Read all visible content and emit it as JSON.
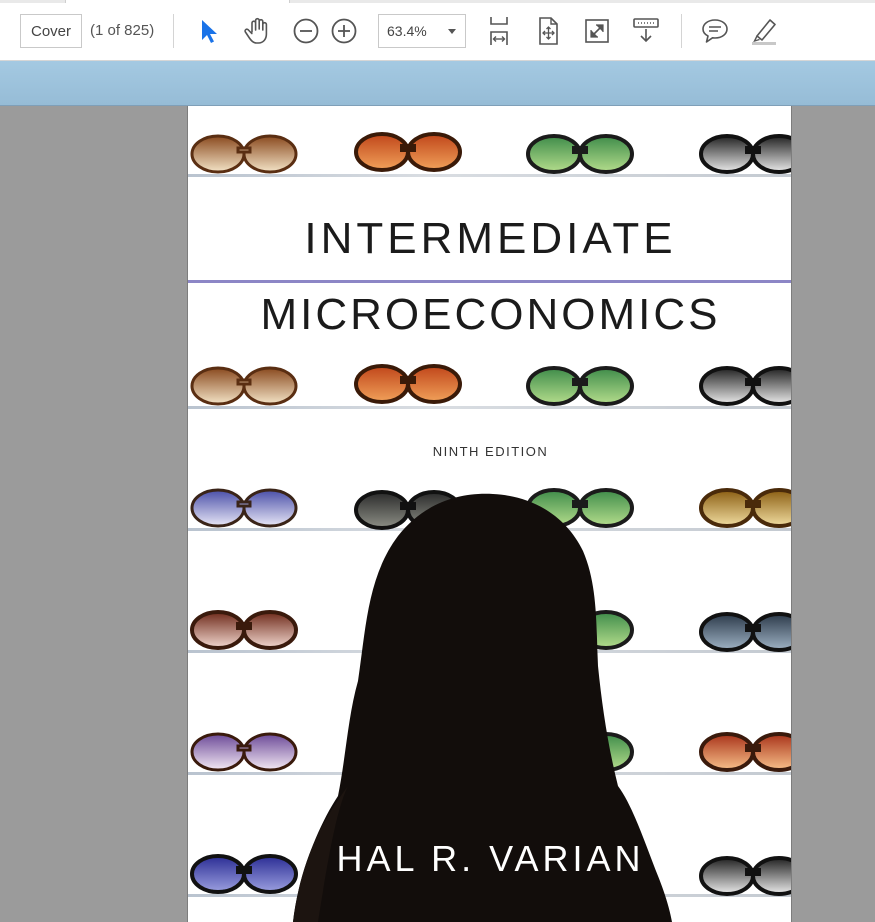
{
  "toolbar": {
    "page_field_value": "Cover",
    "page_count": "(1 of 825)",
    "zoom_value": "63.4%",
    "icons": [
      "select-arrow-icon",
      "hand-icon",
      "zoom-out-icon",
      "zoom-in-icon",
      "fit-page-icon",
      "rotate-page-icon",
      "fullscreen-icon",
      "read-mode-icon",
      "comment-icon",
      "highlight-icon"
    ],
    "accent_color": "#1a73e8"
  },
  "document": {
    "title_line1": "INTERMEDIATE",
    "title_line2": "MICROECONOMICS",
    "edition": "NINTH EDITION",
    "author": "HAL R. VARIAN"
  },
  "colors": {
    "viewer_background": "#9b9b9b",
    "banner_blue": "#9fc3dc",
    "title_rule": "#8c86c6"
  }
}
